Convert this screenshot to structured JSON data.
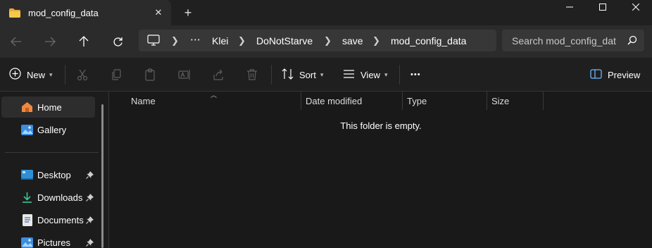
{
  "window": {
    "tab_title": "mod_config_data",
    "new_tab_label": "+"
  },
  "breadcrumb": {
    "overflow": "⋯",
    "items": [
      "Klei",
      "DoNotStarve",
      "save",
      "mod_config_data"
    ]
  },
  "search": {
    "placeholder": "Search mod_config_dat"
  },
  "toolbar": {
    "new_label": "New",
    "sort_label": "Sort",
    "view_label": "View",
    "more_label": "•••",
    "preview_label": "Preview"
  },
  "sidebar": {
    "items": [
      {
        "label": "Home",
        "icon": "home-icon"
      },
      {
        "label": "Gallery",
        "icon": "gallery-icon"
      },
      {
        "label": "Desktop",
        "icon": "desktop-icon"
      },
      {
        "label": "Downloads",
        "icon": "downloads-icon"
      },
      {
        "label": "Documents",
        "icon": "documents-icon"
      },
      {
        "label": "Pictures",
        "icon": "pictures-icon"
      }
    ]
  },
  "columns": [
    "Name",
    "Date modified",
    "Type",
    "Size"
  ],
  "content": {
    "empty_message": "This folder is empty."
  },
  "colors": {
    "accent": "#f0c24b",
    "background": "#191919",
    "toolbar": "#1f1f1f",
    "active_item": "#2d2d2d"
  }
}
